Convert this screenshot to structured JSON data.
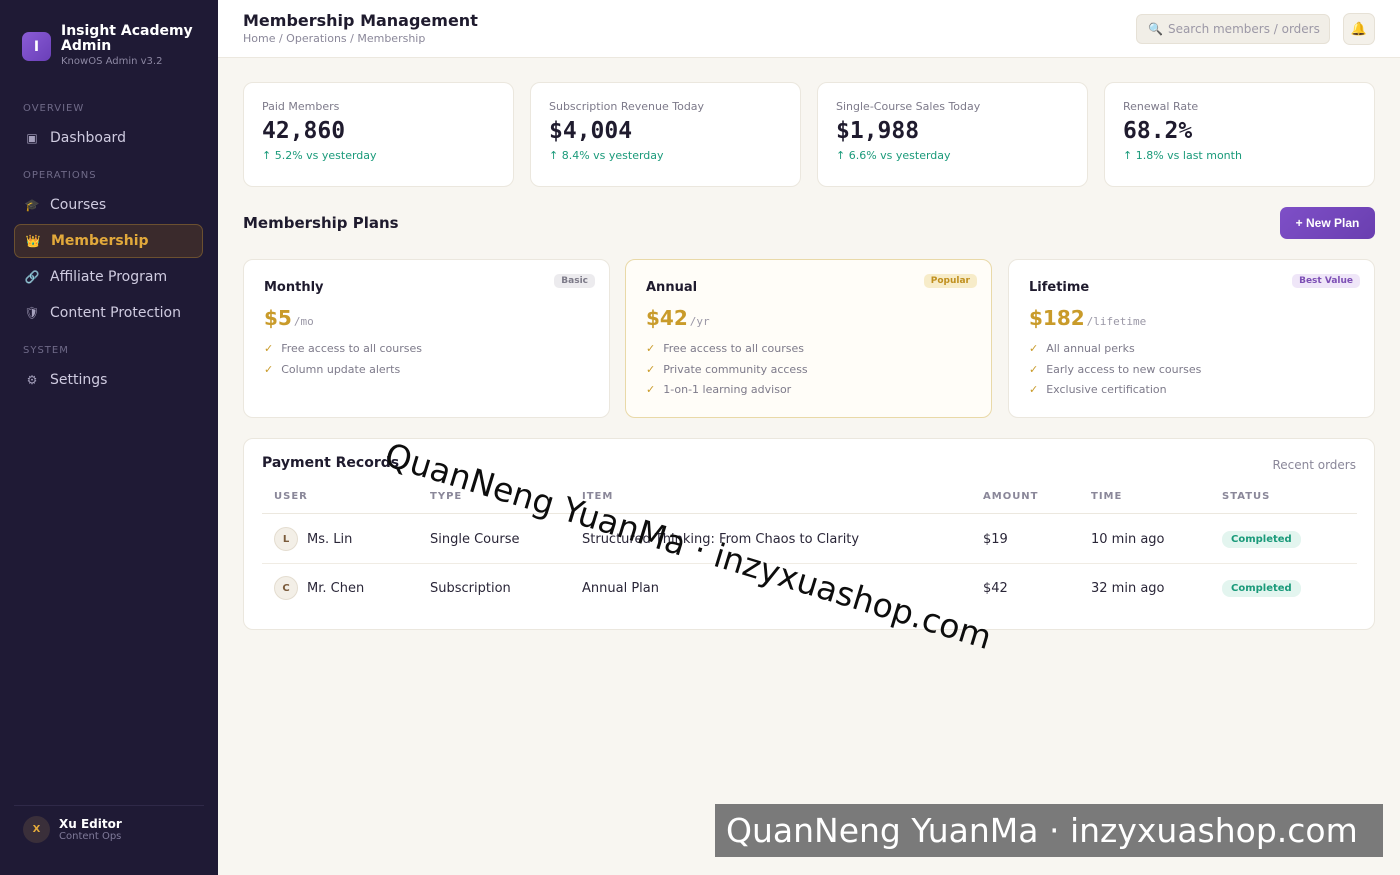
{
  "sidebar": {
    "brand_initial": "I",
    "brand_name": "Insight Academy Admin",
    "brand_sub": "KnowOS Admin v3.2",
    "sections": [
      "OVERVIEW",
      "OPERATIONS",
      "SYSTEM"
    ],
    "items": [
      {
        "label": "Dashboard",
        "icon": "dashboard-icon",
        "glyph": "▣"
      },
      {
        "label": "Courses",
        "icon": "graduation-cap-icon",
        "glyph": "🎓"
      },
      {
        "label": "Membership",
        "icon": "crown-icon",
        "glyph": "👑",
        "active": true
      },
      {
        "label": "Affiliate Program",
        "icon": "link-icon",
        "glyph": "🔗"
      },
      {
        "label": "Content Protection",
        "icon": "shield-icon",
        "glyph": "🛡"
      },
      {
        "label": "Settings",
        "icon": "gear-icon",
        "glyph": "⚙"
      }
    ],
    "user": {
      "initial": "X",
      "name": "Xu Editor",
      "role": "Content Ops"
    }
  },
  "header": {
    "title": "Membership Management",
    "breadcrumb": "Home / Operations / Membership",
    "search_placeholder": "Search members / orders",
    "search_icon": "🔍",
    "bell_icon": "🔔"
  },
  "stats": [
    {
      "label": "Paid Members",
      "value": "42,860",
      "delta": "↑ 5.2% vs yesterday"
    },
    {
      "label": "Subscription Revenue Today",
      "value": "$4,004",
      "delta": "↑ 8.4% vs yesterday"
    },
    {
      "label": "Single-Course Sales Today",
      "value": "$1,988",
      "delta": "↑ 6.6% vs yesterday"
    },
    {
      "label": "Renewal Rate",
      "value": "68.2%",
      "delta": "↑ 1.8% vs last month"
    }
  ],
  "plans_section": {
    "title": "Membership Plans",
    "new_plan_label": "+ New Plan"
  },
  "plans": [
    {
      "name": "Monthly",
      "badge": "Basic",
      "amount": "$5",
      "unit": "/mo",
      "features": [
        "Free access to all courses",
        "Column update alerts"
      ]
    },
    {
      "name": "Annual",
      "badge": "Popular",
      "amount": "$42",
      "unit": "/yr",
      "features": [
        "Free access to all courses",
        "Private community access",
        "1-on-1 learning advisor"
      ]
    },
    {
      "name": "Lifetime",
      "badge": "Best Value",
      "amount": "$182",
      "unit": "/lifetime",
      "features": [
        "All annual perks",
        "Early access to new courses",
        "Exclusive certification"
      ]
    }
  ],
  "records": {
    "title": "Payment Records",
    "subtitle": "Recent orders",
    "headers": [
      "USER",
      "TYPE",
      "ITEM",
      "AMOUNT",
      "TIME",
      "STATUS"
    ],
    "rows": [
      {
        "initial": "L",
        "user": "Ms. Lin",
        "type": "Single Course",
        "item": "Structured Thinking: From Chaos to Clarity",
        "amount": "$19",
        "time": "10 min ago",
        "status": "Completed"
      },
      {
        "initial": "C",
        "user": "Mr. Chen",
        "type": "Subscription",
        "item": "Annual Plan",
        "amount": "$42",
        "time": "32 min ago",
        "status": "Completed"
      }
    ]
  },
  "watermark": {
    "diagonal": "QuanNeng YuanMa · inzyxuashop.com",
    "bar": "QuanNeng YuanMa · inzyxuashop.com"
  },
  "colors": {
    "sidebar_bg": "#1f1a35",
    "accent_gold": "#c99b2a",
    "accent_purple": "#7e4fc7",
    "success_green": "#1a9a7a"
  }
}
